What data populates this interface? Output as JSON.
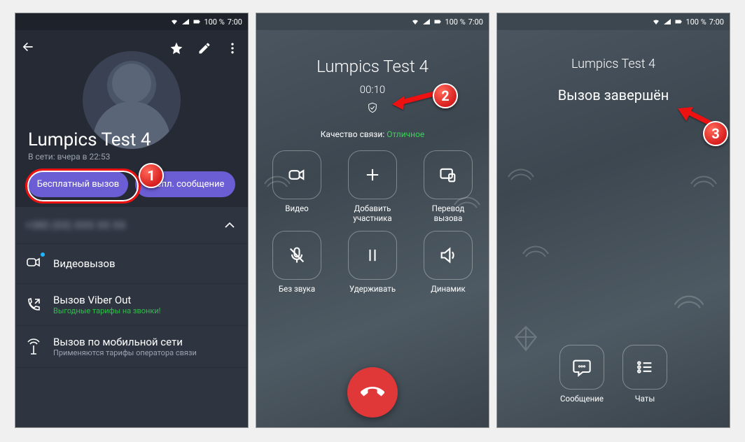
{
  "status": {
    "battery": "100 %",
    "time": "7:00"
  },
  "screen1": {
    "contact_name": "Lumpics Test 4",
    "last_seen": "В сети: вчера в 22:53",
    "free_call_label": "Бесплатный вызов",
    "free_msg_label": "Беспл. сообщение",
    "phone_masked": "+380 (XX) XXX XX XX",
    "row_video": "Видеовызов",
    "row_viberout": "Вызов Viber Out",
    "row_viberout_sub": "Выгодные тарифы на звонки!",
    "row_cellular": "Вызов по мобильной сети",
    "row_cellular_sub": "Применяются тарифы оператора связи"
  },
  "screen2": {
    "contact_name": "Lumpics Test 4",
    "timer": "00:10",
    "quality_label": "Качество связи:",
    "quality_value": "Отличное",
    "btns": {
      "video": "Видео",
      "add": "Добавить участника",
      "transfer": "Перевод вызова",
      "mute": "Без звука",
      "hold": "Удерживать",
      "speaker": "Динамик"
    }
  },
  "screen3": {
    "contact_name": "Lumpics Test 4",
    "ended": "Вызов завершён",
    "msg_label": "Сообщение",
    "chats_label": "Чаты"
  },
  "badges": {
    "b1": "1",
    "b2": "2",
    "b3": "3"
  }
}
